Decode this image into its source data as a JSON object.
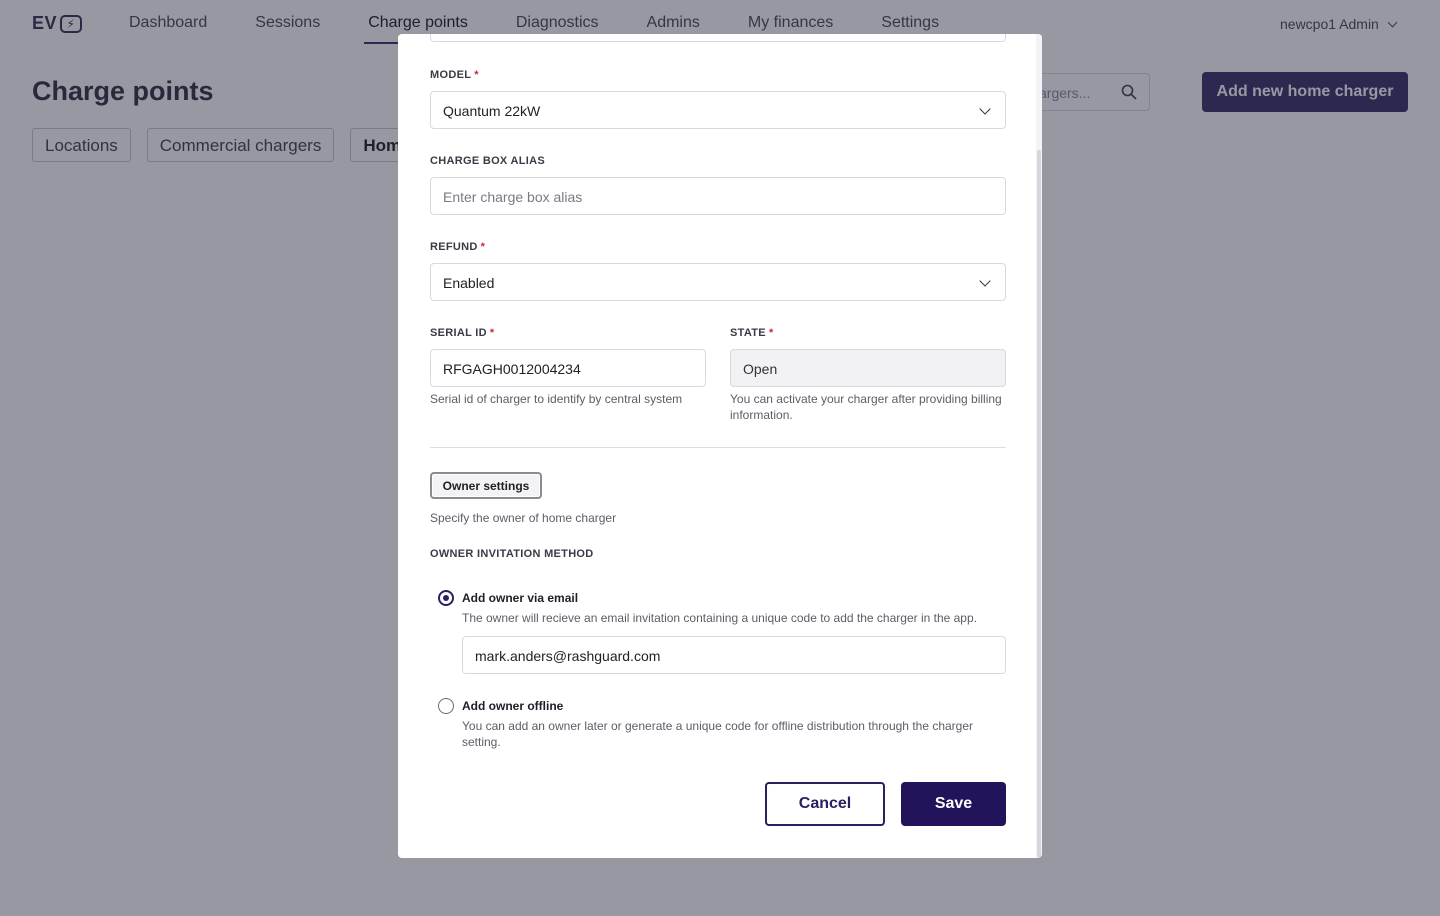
{
  "app": {
    "logo_text": "EV",
    "nav": [
      "Dashboard",
      "Sessions",
      "Charge points",
      "Diagnostics",
      "Admins",
      "My finances",
      "Settings"
    ],
    "active_nav": "Charge points",
    "user": "newcpo1 Admin",
    "page_title": "Charge points",
    "search_placeholder": "argers...",
    "add_button": "Add new home charger",
    "tabs": [
      "Locations",
      "Commercial chargers",
      "Home"
    ]
  },
  "modal": {
    "model": {
      "label": "MODEL",
      "value": "Quantum 22kW"
    },
    "alias": {
      "label": "CHARGE BOX ALIAS",
      "placeholder": "Enter charge box alias"
    },
    "refund": {
      "label": "REFUND",
      "value": "Enabled"
    },
    "serial": {
      "label": "SERIAL ID",
      "value": "RFGAGH0012004234",
      "help": "Serial id of charger to identify by central system"
    },
    "state": {
      "label": "STATE",
      "value": "Open",
      "help": "You can activate your charger after providing billing information."
    },
    "owner_settings_button": "Owner settings",
    "owner_settings_help": "Specify the owner of home charger",
    "invitation_label": "OWNER INVITATION METHOD",
    "option_email": {
      "label": "Add owner via email",
      "help": "The owner will recieve an email invitation containing a unique code to add the charger in the app.",
      "email": "mark.anders@rashguard.com",
      "selected": true
    },
    "option_offline": {
      "label": "Add owner offline",
      "help": "You can add an owner later or generate a unique code for offline distribution through the charger setting.",
      "selected": false
    },
    "cancel": "Cancel",
    "save": "Save"
  }
}
